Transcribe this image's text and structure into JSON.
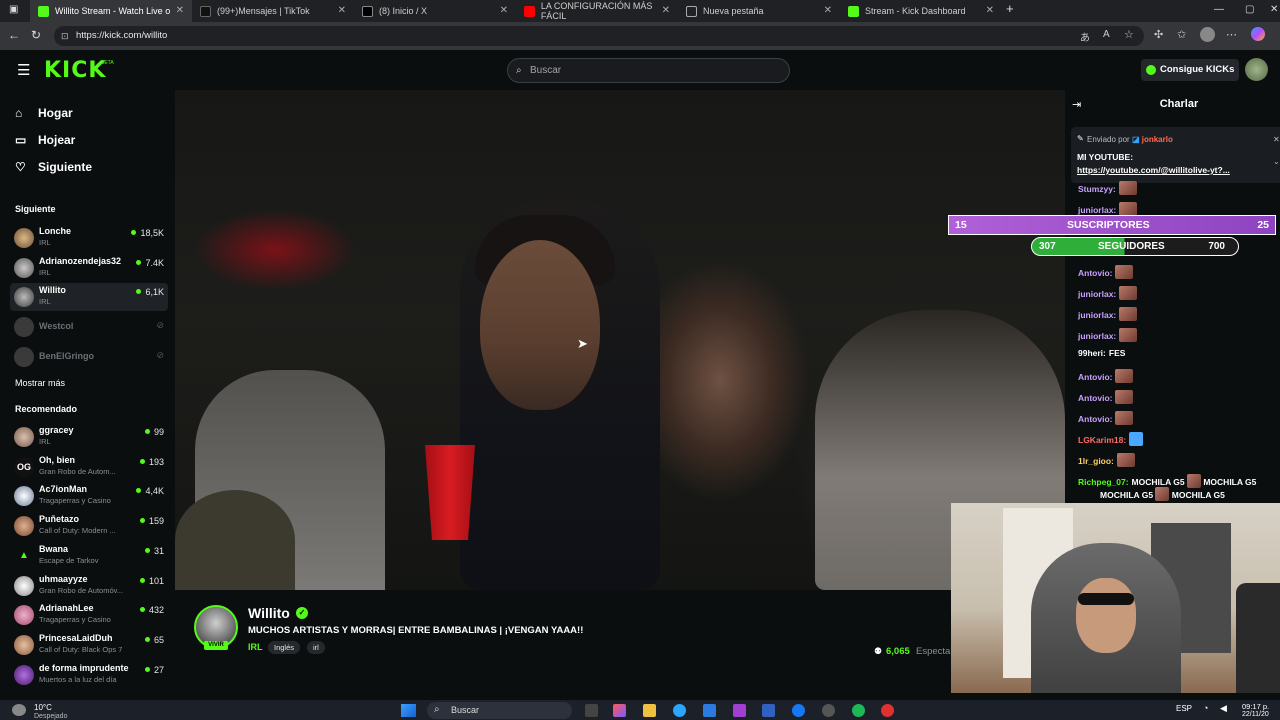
{
  "browser": {
    "tabs": [
      {
        "title": "Willito Stream - Watch Live o",
        "active": true
      },
      {
        "title": "(99+)Mensajes | TikTok"
      },
      {
        "title": "(8) Inicio / X"
      },
      {
        "title": "LA CONFIGURACIÓN MÁS FÁCIL"
      },
      {
        "title": "Nueva pestaña"
      },
      {
        "title": "Stream - Kick Dashboard"
      }
    ],
    "url": "https://kick.com/willito"
  },
  "header": {
    "logo": "KICK",
    "logo_badge": "BETA",
    "search_placeholder": "Buscar",
    "kicks_button": "Consigue KICKs"
  },
  "sidebar": {
    "nav": [
      {
        "label": "Hogar",
        "icon": "home-icon"
      },
      {
        "label": "Hojear",
        "icon": "browse-icon"
      },
      {
        "label": "Siguiente",
        "icon": "heart-icon"
      }
    ],
    "following_title": "Siguiente",
    "following": [
      {
        "name": "Lonche",
        "category": "IRL",
        "viewers": "18,5K"
      },
      {
        "name": "Adrianozendejas32",
        "category": "IRL",
        "viewers": "7.4K"
      },
      {
        "name": "Willito",
        "category": "IRL",
        "viewers": "6,1K"
      },
      {
        "name": "Westcol",
        "category": "",
        "viewers": ""
      },
      {
        "name": "BenElGringo",
        "category": "",
        "viewers": ""
      }
    ],
    "show_more": "Mostrar más",
    "recommended_title": "Recomendado",
    "recommended": [
      {
        "name": "ggracey",
        "category": "IRL",
        "viewers": "99"
      },
      {
        "name": "Oh, bien",
        "category": "Gran Robo de Autom...",
        "viewers": "193"
      },
      {
        "name": "Ac7ionMan",
        "category": "Tragaperras y Casino",
        "viewers": "4,4K"
      },
      {
        "name": "Puñetazo",
        "category": "Call of Duty: Modern ...",
        "viewers": "159"
      },
      {
        "name": "Bwana",
        "category": "Escape de Tarkov",
        "viewers": "31"
      },
      {
        "name": "uhmaayyze",
        "category": "Gran Robo de Automóv...",
        "viewers": "101"
      },
      {
        "name": "AdrianahLee",
        "category": "Tragaperras y Casino",
        "viewers": "432"
      },
      {
        "name": "PrincesaLaidDuh",
        "category": "Call of Duty: Black Ops 7",
        "viewers": "65"
      },
      {
        "name": "de forma imprudente",
        "category": "Muertos a la luz del día",
        "viewers": "27"
      }
    ]
  },
  "stream": {
    "live_badge": "VIVIR",
    "streamer": "Willito",
    "title": "MUCHOS ARTISTAS Y MORRAS| ENTRE BAMBALINAS | ¡VENGAN YAAA!!",
    "category": "IRL",
    "tags": [
      "Inglés",
      "irl"
    ],
    "viewers": "6,065",
    "viewers_label": "Especta"
  },
  "chat": {
    "title": "Charlar",
    "pinned_by_label": "Enviado por",
    "pinned_by": "jonkarlo",
    "pinned_line1": "MI YOUTUBE:",
    "pinned_line2": "https://youtube.com/@willitolive-yt?...",
    "messages": [
      {
        "user": "Stumzyy:",
        "text": "",
        "color": "#c9a0ff"
      },
      {
        "user": "juniorlax:",
        "text": "",
        "color": "#c9a0ff"
      },
      {
        "user": "Antovio:",
        "text": "",
        "color": "#c9a0ff"
      },
      {
        "user": "juniorlax:",
        "text": "",
        "color": "#c9a0ff"
      },
      {
        "user": "juniorlax:",
        "text": "",
        "color": "#c9a0ff"
      },
      {
        "user": "juniorlax:",
        "text": "",
        "color": "#c9a0ff"
      },
      {
        "user": "99heri:",
        "text": "FES",
        "color": "#ffffff"
      },
      {
        "user": "Antovio:",
        "text": "",
        "color": "#c9a0ff"
      },
      {
        "user": "Antovio:",
        "text": "",
        "color": "#c9a0ff"
      },
      {
        "user": "Antovio:",
        "text": "",
        "color": "#c9a0ff"
      },
      {
        "user": "LGKarim18:",
        "text": "",
        "color": "#ff6a6a"
      },
      {
        "user": "1lr_gioo:",
        "text": "",
        "color": "#ffd166"
      },
      {
        "user": "Richpeg_07:",
        "text": "MOCHILA G5",
        "color": "#53fc18"
      }
    ],
    "rich_line2": "MOCHILA G5",
    "rich_line2b": "MOCHILA G5",
    "rich_line1b": "MOCHILA G5"
  },
  "overlay": {
    "subs_current": "15",
    "subs_label": "SUSCRIPTORES",
    "subs_goal": "25",
    "follow_current": "307",
    "follow_label": "SEGUIDORES",
    "follow_goal": "700"
  },
  "taskbar": {
    "weather_temp": "10°C",
    "weather_desc": "Despejado",
    "search": "Buscar",
    "lang": "ESP",
    "time": "09:17 p.",
    "date": "22/11/20"
  }
}
